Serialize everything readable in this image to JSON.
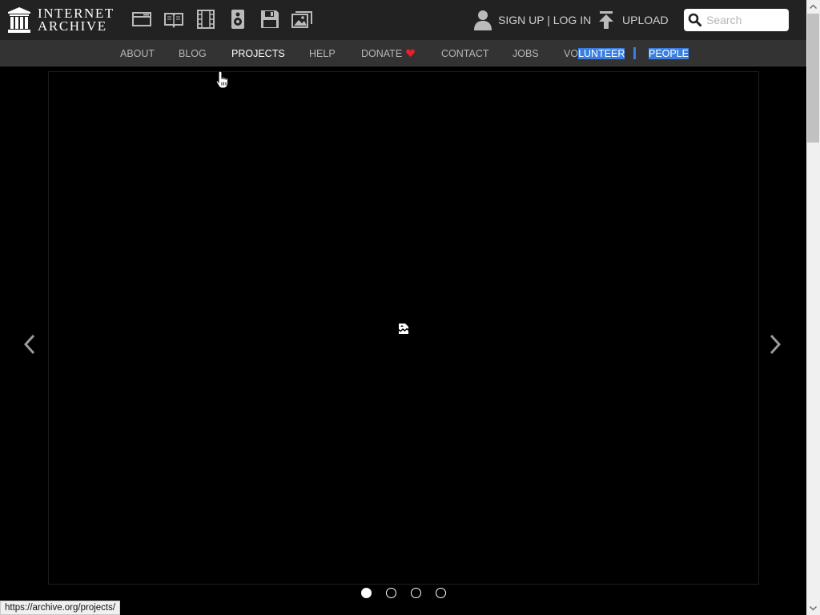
{
  "header": {
    "logo": {
      "line1": "INTERNET",
      "line2": "ARCHIVE"
    },
    "media_icons": [
      "web-icon",
      "texts-icon",
      "video-icon",
      "audio-icon",
      "software-icon",
      "images-icon"
    ],
    "account": {
      "signup": "SIGN UP",
      "separator": " | ",
      "login": "LOG IN"
    },
    "upload": "UPLOAD",
    "search": {
      "placeholder": "Search",
      "value": ""
    }
  },
  "nav": {
    "items": [
      "ABOUT",
      "BLOG",
      "PROJECTS",
      "HELP",
      "DONATE",
      "CONTACT",
      "JOBS"
    ],
    "active": "PROJECTS",
    "volunteer": {
      "unselected": "VO",
      "selected": "LUNTEER"
    },
    "people": "PEOPLE"
  },
  "carousel": {
    "slide_count": 4,
    "active_slide": 1
  },
  "status_bar": {
    "url": "https://archive.org/projects/"
  },
  "colors": {
    "topbar": "#222222",
    "navbar": "#333333",
    "selection": "#3a7ee0",
    "donate_heart": "#e8202a"
  }
}
